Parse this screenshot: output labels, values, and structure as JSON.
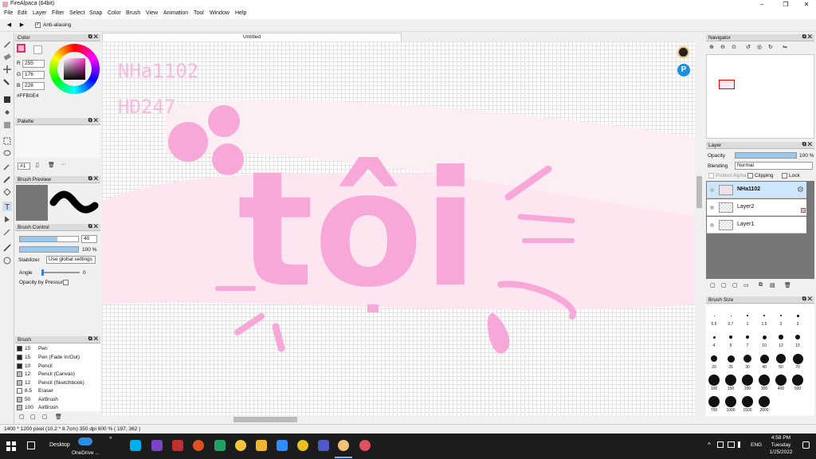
{
  "window": {
    "title": "FireAlpaca (64bit)",
    "minimize": "–",
    "maximize": "❐",
    "close": "✕"
  },
  "menu": [
    "File",
    "Edit",
    "Layer",
    "Filter",
    "Select",
    "Snap",
    "Color",
    "Brush",
    "View",
    "Animation",
    "Tool",
    "Window",
    "Help"
  ],
  "toolbar": {
    "antialias_label": "Anti-aliasing",
    "prev": "◀",
    "next": "▶"
  },
  "color_panel": {
    "title": "Color",
    "r_label": "R",
    "g_label": "G",
    "b_label": "B",
    "r": "255",
    "g": "176",
    "b": "228",
    "hex": "#FFB0E4",
    "color": "#ffb0e4"
  },
  "palette_panel": {
    "title": "Palette",
    "index": "#1",
    "more": "···"
  },
  "brush_preview_panel": {
    "title": "Brush Preview"
  },
  "brush_control": {
    "title": "Brush Control",
    "size": "40",
    "opacity": "100 %",
    "stabilizer_label": "Stabilizer",
    "stabilizer_value": "Use global settings",
    "angle_label": "Angle",
    "angle_value": "0",
    "opacity_pressure_label": "Opacity by Pressure"
  },
  "brush_panel": {
    "title": "Brush",
    "items": [
      {
        "size": "15",
        "name": "Pen",
        "color": "#222222"
      },
      {
        "size": "15",
        "name": "Pen (Fade In/Out)",
        "color": "#222222"
      },
      {
        "size": "10",
        "name": "Pencil",
        "color": "#222222"
      },
      {
        "size": "12",
        "name": "Pencil (Canvas)",
        "color": "#bbbbbb"
      },
      {
        "size": "12",
        "name": "Pencil (Sketchbook)",
        "color": "#bbbbbb"
      },
      {
        "size": "8.5",
        "name": "Eraser",
        "color": "#ffffff"
      },
      {
        "size": "50",
        "name": "AirBrush",
        "color": "#bbbbbb"
      },
      {
        "size": "100",
        "name": "AirBrush",
        "color": "#bbbbbb"
      }
    ]
  },
  "canvas": {
    "tab_label": "Untitled",
    "watermark_line1": "NHa1102",
    "watermark_line2": "HĐ247",
    "main_text": "tôi",
    "accent": "#f7a8d8",
    "bg_pink": "#fde6ef"
  },
  "navigator": {
    "title": "Navigator"
  },
  "layer_panel": {
    "title": "Layer",
    "opacity_label": "Opacity",
    "opacity_value": "100 %",
    "opacity_fraction": 1.0,
    "blending_label": "Blending",
    "blending_value": "Normal",
    "protect_alpha": "Protect Alpha",
    "clipping": "Clipping",
    "lock": "Lock",
    "layers": [
      {
        "name": "NHa1102",
        "selected": true
      },
      {
        "name": "Layer2",
        "selected": false
      },
      {
        "name": "Layer1",
        "selected": false
      }
    ]
  },
  "brush_size_panel": {
    "title": "Brush Size",
    "sizes": [
      "0.5",
      "0.7",
      "1",
      "1.5",
      "2",
      "3",
      "4",
      "5",
      "7",
      "10",
      "12",
      "15",
      "20",
      "25",
      "30",
      "40",
      "50",
      "70",
      "100",
      "150",
      "200",
      "300",
      "400",
      "500",
      "700",
      "1000",
      "1500",
      "2000"
    ]
  },
  "status": {
    "text": "1400 * 1200 pixel  (10.2 * 8.7cm)  350 dpi  600 %  ( 197, 362 )"
  },
  "taskbar": {
    "desktop": "Desktop",
    "onedrive": "OneDrive ...",
    "lang": "ENG",
    "time": "4:58 PM",
    "day": "Tuesday",
    "date": "1/25/2022"
  }
}
